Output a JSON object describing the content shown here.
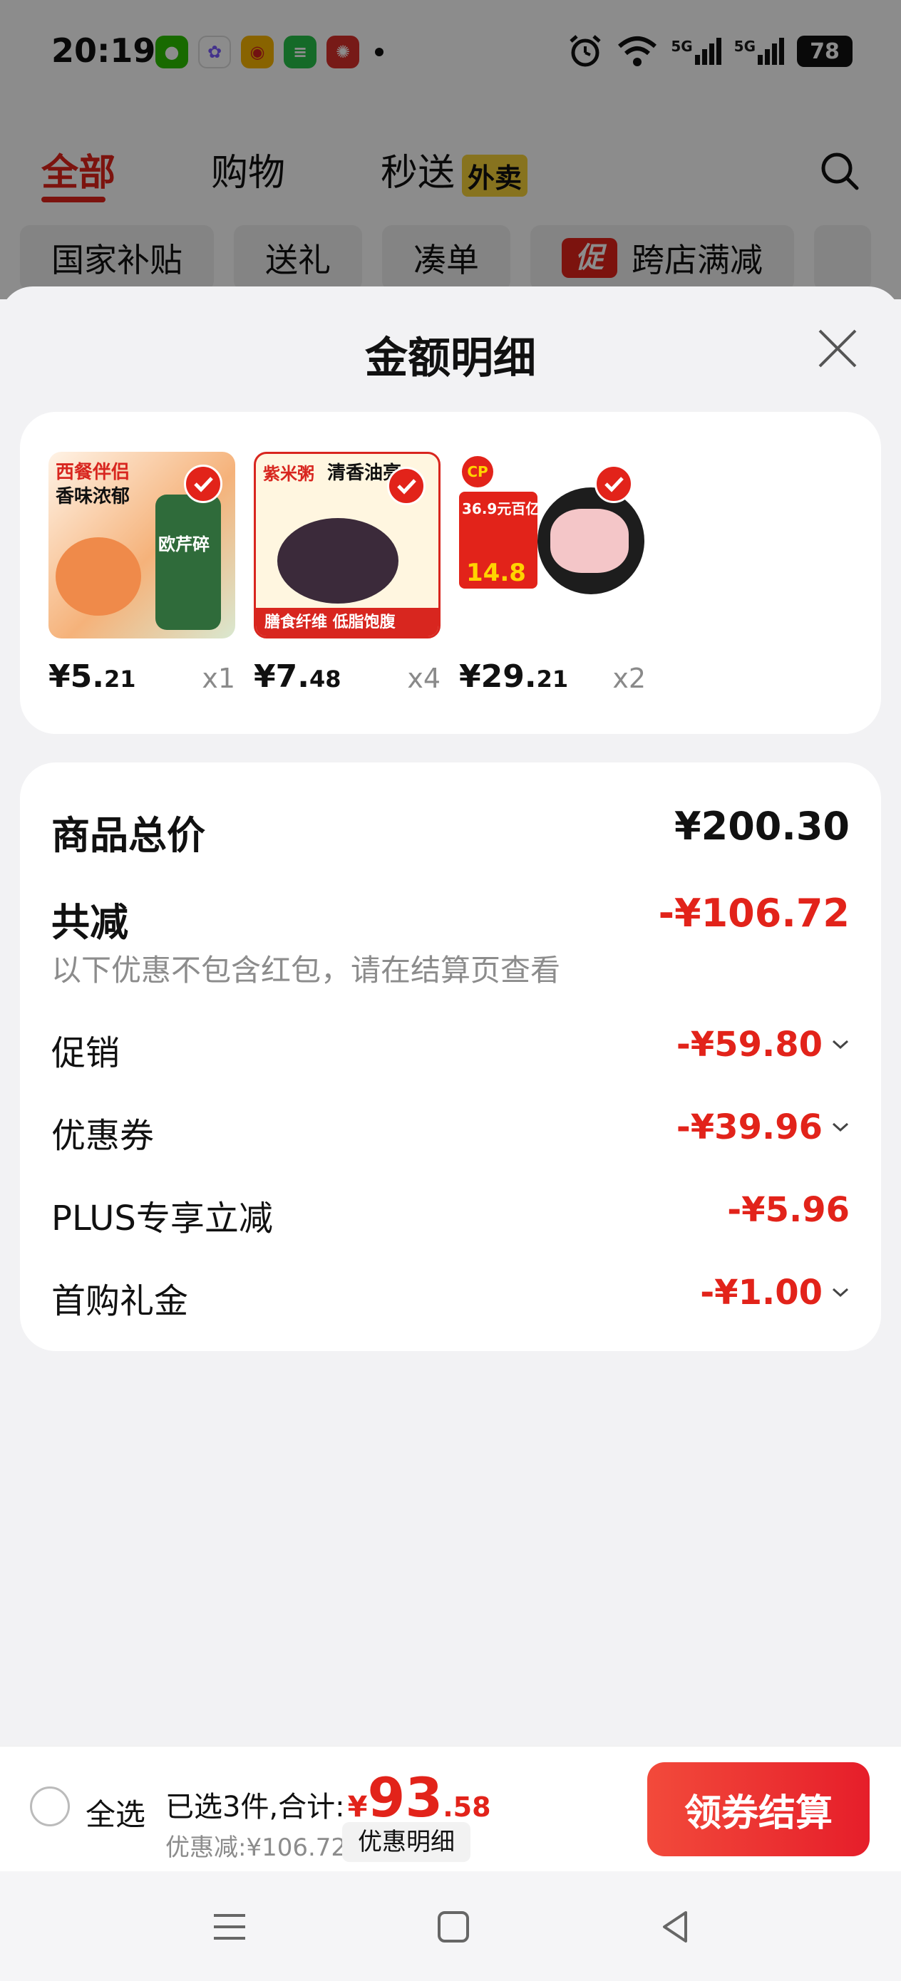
{
  "status_bar": {
    "time": "20:19",
    "battery": "78",
    "network_1": "5G",
    "network_2": "5G"
  },
  "background_page": {
    "tabs": [
      {
        "label": "全部",
        "active": true
      },
      {
        "label": "购物",
        "active": false
      },
      {
        "label": "秒送",
        "active": false,
        "badge": "外卖"
      }
    ],
    "chips": [
      "国家补贴",
      "送礼",
      "凑单",
      "跨店满减"
    ],
    "promo_tag": "促"
  },
  "sheet": {
    "title": "金额明细",
    "products": [
      {
        "price_int": "¥5.",
        "price_dec": "21",
        "qty": "x1",
        "image_text": [
          "西餐伴侣",
          "香味浓郁",
          "欧芹碎"
        ],
        "color": "#e87a3a"
      },
      {
        "price_int": "¥7.",
        "price_dec": "48",
        "qty": "x4",
        "image_text": [
          "紫米粥",
          "清香油亮",
          "膳食纤维 低脂饱腹"
        ],
        "color": "#3b2a3a"
      },
      {
        "price_int": "¥29.",
        "price_dec": "21",
        "qty": "x2",
        "image_text": [
          "CP",
          "36.9元百亿",
          "14.8"
        ],
        "color": "#f4c6c8"
      }
    ],
    "summary": {
      "total_label": "商品总价",
      "total_value": "¥200.30",
      "reduce_label": "共减",
      "reduce_value": "-¥106.72",
      "note": "以下优惠不包含红包，请在结算页查看",
      "items": [
        {
          "label": "促销",
          "value": "-¥59.80",
          "expandable": true
        },
        {
          "label": "优惠券",
          "value": "-¥39.96",
          "expandable": true
        },
        {
          "label": "PLUS专享立减",
          "value": "-¥5.96",
          "expandable": false
        },
        {
          "label": "首购礼金",
          "value": "-¥1.00",
          "expandable": true
        }
      ]
    }
  },
  "bottom_bar": {
    "select_all": "全选",
    "selected_prefix": "已选3件,合计:",
    "total_yen": "¥",
    "total_int": "93",
    "total_dec": ".58",
    "discount_text": "优惠减:¥106.72",
    "detail_button": "优惠明细",
    "checkout_button": "领券结算"
  },
  "colors": {
    "accent": "#e2231a",
    "checkout_gradient_start": "#f24a3b",
    "checkout_gradient_end": "#e61e2a"
  }
}
